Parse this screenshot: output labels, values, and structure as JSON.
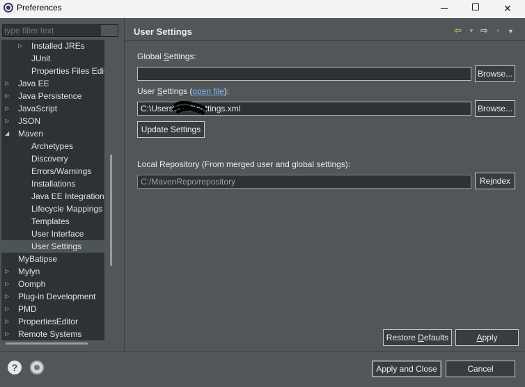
{
  "window": {
    "title": "Preferences",
    "minimize": "—",
    "maximize": "☐",
    "close": "✕"
  },
  "filter": {
    "placeholder": "type filter text"
  },
  "tree": {
    "items": [
      {
        "label": "Installed JREs",
        "level": 2,
        "expandable": true,
        "expanded": false
      },
      {
        "label": "JUnit",
        "level": 2,
        "expandable": false
      },
      {
        "label": "Properties Files Editor",
        "level": 2,
        "expandable": false
      },
      {
        "label": "Java EE",
        "level": 1,
        "expandable": true,
        "expanded": false
      },
      {
        "label": "Java Persistence",
        "level": 1,
        "expandable": true,
        "expanded": false
      },
      {
        "label": "JavaScript",
        "level": 1,
        "expandable": true,
        "expanded": false
      },
      {
        "label": "JSON",
        "level": 1,
        "expandable": true,
        "expanded": false
      },
      {
        "label": "Maven",
        "level": 1,
        "expandable": true,
        "expanded": true
      },
      {
        "label": "Archetypes",
        "level": 2,
        "expandable": false
      },
      {
        "label": "Discovery",
        "level": 2,
        "expandable": false
      },
      {
        "label": "Errors/Warnings",
        "level": 2,
        "expandable": false
      },
      {
        "label": "Installations",
        "level": 2,
        "expandable": false
      },
      {
        "label": "Java EE Integration",
        "level": 2,
        "expandable": false
      },
      {
        "label": "Lifecycle Mappings",
        "level": 2,
        "expandable": false
      },
      {
        "label": "Templates",
        "level": 2,
        "expandable": false
      },
      {
        "label": "User Interface",
        "level": 2,
        "expandable": false
      },
      {
        "label": "User Settings",
        "level": 2,
        "expandable": false,
        "selected": true
      },
      {
        "label": "MyBatipse",
        "level": 1,
        "expandable": false
      },
      {
        "label": "Mylyn",
        "level": 1,
        "expandable": true,
        "expanded": false
      },
      {
        "label": "Oomph",
        "level": 1,
        "expandable": true,
        "expanded": false
      },
      {
        "label": "Plug-in Development",
        "level": 1,
        "expandable": true,
        "expanded": false
      },
      {
        "label": "PMD",
        "level": 1,
        "expandable": true,
        "expanded": false
      },
      {
        "label": "PropertiesEditor",
        "level": 1,
        "expandable": true,
        "expanded": false
      },
      {
        "label": "Remote Systems",
        "level": 1,
        "expandable": true,
        "expanded": false
      }
    ]
  },
  "page": {
    "title": "User Settings",
    "global_settings_label_pre": "Global ",
    "global_settings_label_u": "S",
    "global_settings_label_post": "ettings:",
    "global_settings_value": "",
    "browse_label_1": "Browse...",
    "user_settings_label_pre": "User ",
    "user_settings_label_u": "S",
    "user_settings_label_mid": "ettings (",
    "open_file_link": "open file",
    "user_settings_label_post": "):",
    "user_settings_value": "C:\\Users\\       \\.m2\\settings.xml",
    "browse_label_2": "Browse...",
    "update_settings_label": "Update Settings",
    "local_repo_label": "Local Repository (From merged user and global settings):",
    "local_repo_value": "C:/MavenRepo/repository",
    "reindex_pre": "Re",
    "reindex_u": "i",
    "reindex_post": "ndex",
    "restore_defaults_pre": "Restore ",
    "restore_defaults_u": "D",
    "restore_defaults_post": "efaults",
    "apply_u": "A",
    "apply_post": "pply"
  },
  "footer": {
    "help": "?",
    "apply_and_close": "Apply and Close",
    "cancel": "Cancel"
  },
  "colors": {
    "background": "#515658",
    "field": "#2f3235",
    "link": "#7ab8ff",
    "back_arrow": "#f2c86a"
  }
}
